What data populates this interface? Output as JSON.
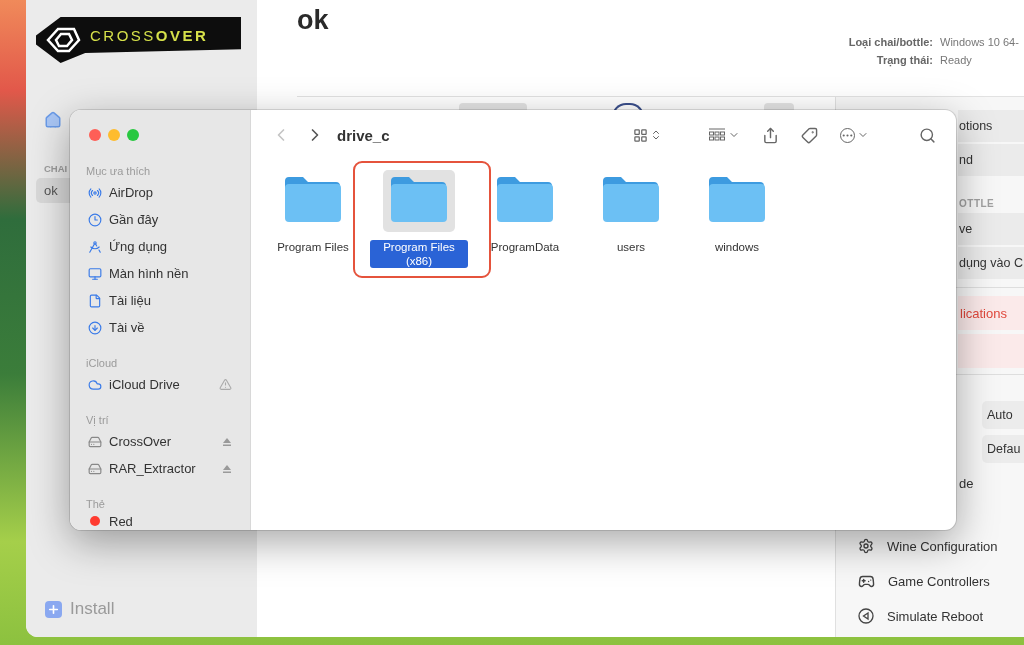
{
  "app": {
    "logo": "CROSS**OVER**",
    "sidebar": {
      "section": "CHAI",
      "items": [
        {
          "label": "ok",
          "selected": true
        }
      ],
      "install": "Install"
    },
    "title": "ok",
    "info": [
      {
        "label": "Loại chai/bottle:",
        "value": "Windows 10 64-"
      },
      {
        "label": "Trạng thái:",
        "value": "Ready"
      }
    ],
    "panel": [
      {
        "kind": "action",
        "label": "otions"
      },
      {
        "kind": "action",
        "label": "nd"
      },
      {
        "kind": "header",
        "label": "OTTLE"
      },
      {
        "kind": "action",
        "label": "ve"
      },
      {
        "kind": "action",
        "label": "dụng vào C"
      },
      {
        "kind": "divider"
      },
      {
        "kind": "danger",
        "label": "lications"
      },
      {
        "kind": "danger"
      },
      {
        "kind": "divider"
      },
      {
        "kind": "select",
        "label": "Auto"
      },
      {
        "kind": "select",
        "label": "Defau"
      },
      {
        "kind": "text",
        "label": "de"
      },
      {
        "kind": "tool",
        "label": "Wine Configuration"
      },
      {
        "kind": "tool",
        "label": "Game Controllers"
      },
      {
        "kind": "tool",
        "label": "Simulate Reboot"
      }
    ]
  },
  "finder": {
    "back_disabled": true,
    "path": "drive_c",
    "sidebar": [
      {
        "title": "Mục ưa thích",
        "items": [
          {
            "label": "AirDrop",
            "kind": "plain"
          },
          {
            "label": "Gần đây",
            "kind": "plain"
          },
          {
            "label": "Ứng dụng",
            "kind": "plain"
          },
          {
            "label": "Màn hình nền",
            "kind": "plain"
          },
          {
            "label": "Tài liệu",
            "kind": "plain"
          },
          {
            "label": "Tài về",
            "kind": "plain"
          }
        ]
      },
      {
        "title": "iCloud",
        "items": [
          {
            "label": "iCloud Drive",
            "kind": "warning"
          }
        ]
      },
      {
        "title": "Vị trí",
        "items": [
          {
            "label": "CrossOver",
            "kind": "ejectable"
          },
          {
            "label": "RAR_Extractor",
            "kind": "ejectable"
          }
        ]
      },
      {
        "title": "Thẻ",
        "items": [
          {
            "label": "Red",
            "kind": "tag",
            "color": "#ff3b30"
          }
        ]
      }
    ],
    "files": [
      {
        "name": "Program Files",
        "selected": false,
        "highlighted": false
      },
      {
        "name": "Program Files (x86)",
        "selected": true,
        "highlighted": true
      },
      {
        "name": "ProgramData",
        "selected": false,
        "highlighted": false
      },
      {
        "name": "users",
        "selected": false,
        "highlighted": false
      },
      {
        "name": "windows",
        "selected": false,
        "highlighted": false
      }
    ]
  }
}
